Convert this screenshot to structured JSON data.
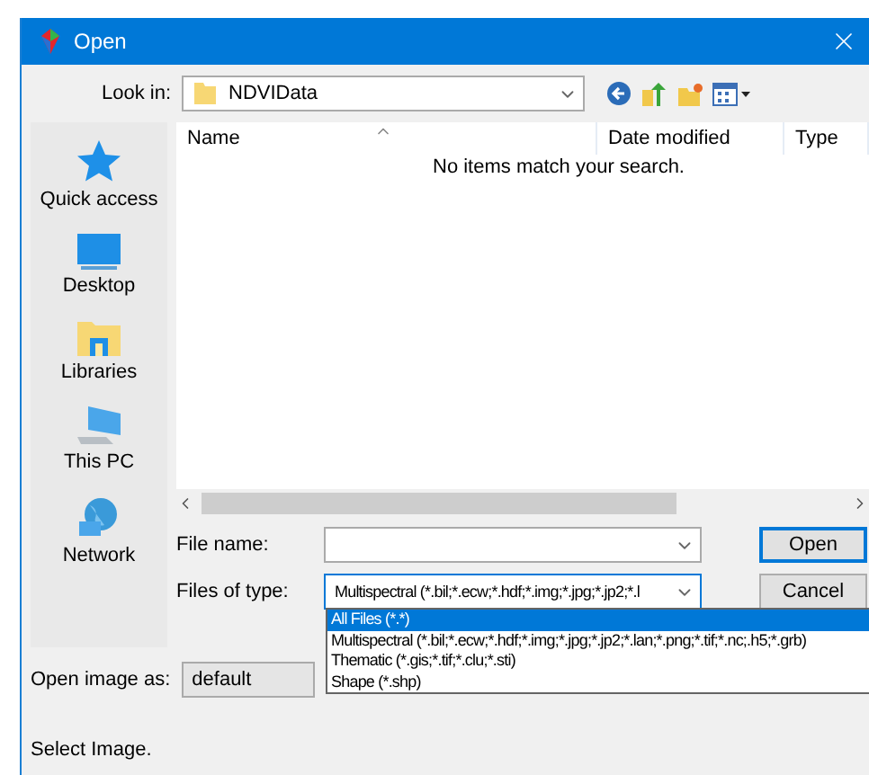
{
  "window": {
    "title": "Open"
  },
  "look_in": {
    "label": "Look in:",
    "value": "NDVIData"
  },
  "sidebar": {
    "items": [
      {
        "label": "Quick access",
        "kind": "star",
        "selected": false
      },
      {
        "label": "Desktop",
        "kind": "desktop",
        "selected": false
      },
      {
        "label": "Libraries",
        "kind": "library",
        "selected": false
      },
      {
        "label": "This PC",
        "kind": "pc",
        "selected": false
      },
      {
        "label": "Network",
        "kind": "network",
        "selected": false
      }
    ]
  },
  "file_list": {
    "columns": [
      "Name",
      "Date modified",
      "Type"
    ],
    "empty_message": "No items match your search."
  },
  "file_name": {
    "label": "File name:"
  },
  "files_of_type": {
    "label": "Files of type:",
    "value": "Multispectral (*.bil;*.ecw;*.hdf;*.img;*.jpg;*.jp2;*.l",
    "expanded": true,
    "options": [
      {
        "label": "All Files (*.*)",
        "selected": true
      },
      {
        "label": "Multispectral (*.bil;*.ecw;*.hdf;*.img;*.jpg;*.jp2;*.lan;*.png;*.tif;*.nc;.h5;*.grb)",
        "selected": false
      },
      {
        "label": "Thematic (*.gis;*.tif;*.clu;*.sti)",
        "selected": false
      },
      {
        "label": "Shape (*.shp)",
        "selected": false
      }
    ]
  },
  "buttons": [
    {
      "label": "Open",
      "default": true
    },
    {
      "label": "Cancel",
      "default": false
    }
  ],
  "open_image_as": {
    "label": "Open image as:",
    "value": "default"
  },
  "status": "Select Image."
}
